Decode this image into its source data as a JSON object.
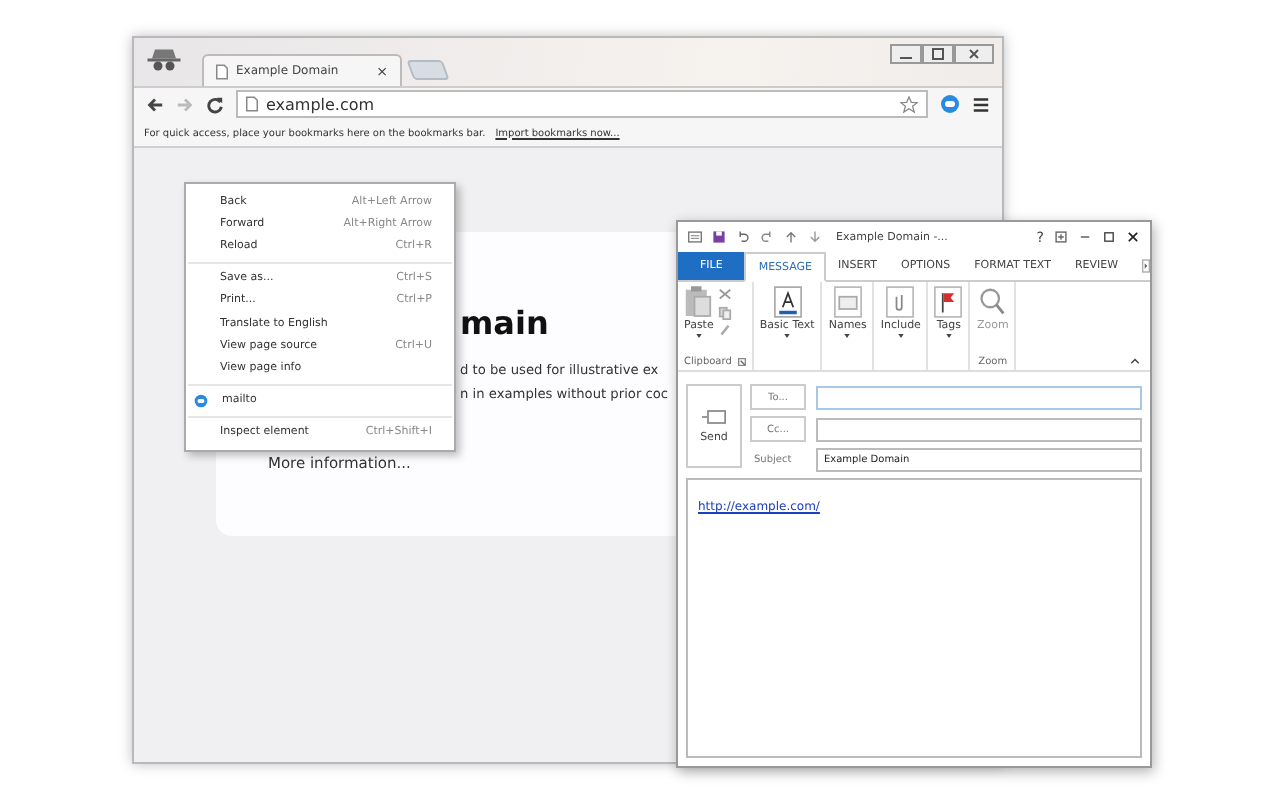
{
  "browser": {
    "tab_title": "Example Domain",
    "tab_close": "×",
    "address": "example.com",
    "bookmarks_prompt": "For quick access, place your bookmarks here on the bookmarks bar.",
    "bookmarks_link": "Import bookmarks now...",
    "page": {
      "heading": "main",
      "lines": [
        "d to be used for illustrative ex",
        "n in examples without prior coc"
      ],
      "link": "More information..."
    }
  },
  "context_menu": [
    {
      "kind": "item",
      "label": "Back",
      "shortcut": "Alt+Left Arrow"
    },
    {
      "kind": "item",
      "label": "Forward",
      "shortcut": "Alt+Right Arrow"
    },
    {
      "kind": "item",
      "label": "Reload",
      "shortcut": "Ctrl+R"
    },
    {
      "kind": "separator"
    },
    {
      "kind": "item",
      "label": "Save as...",
      "shortcut": "Ctrl+S"
    },
    {
      "kind": "item",
      "label": "Print...",
      "shortcut": "Ctrl+P"
    },
    {
      "kind": "item",
      "label": "Translate to English"
    },
    {
      "kind": "item",
      "label": "View page source",
      "shortcut": "Ctrl+U"
    },
    {
      "kind": "item",
      "label": "View page info"
    },
    {
      "kind": "separator"
    },
    {
      "kind": "extension",
      "label": "mailto"
    },
    {
      "kind": "separator"
    },
    {
      "kind": "item",
      "label": "Inspect element",
      "shortcut": "Ctrl+Shift+I"
    }
  ],
  "compose": {
    "title": "Example Domain -...",
    "help": "?",
    "tabs": [
      {
        "label": "FILE",
        "kind": "file",
        "selected": false
      },
      {
        "label": "MESSAGE",
        "kind": "tab",
        "selected": true
      },
      {
        "label": "INSERT",
        "kind": "tab",
        "selected": false
      },
      {
        "label": "OPTIONS",
        "kind": "tab",
        "selected": false
      },
      {
        "label": "FORMAT TEXT",
        "kind": "tab",
        "selected": false
      },
      {
        "label": "REVIEW",
        "kind": "tab",
        "selected": false
      }
    ],
    "groups": [
      {
        "name": "Clipboard",
        "buttons": [
          {
            "kind": "paste",
            "label": "Paste",
            "dropdown": true
          }
        ]
      },
      {
        "buttons": [
          {
            "kind": "text",
            "label": "Basic Text",
            "dropdown": true
          }
        ]
      },
      {
        "buttons": [
          {
            "kind": "names",
            "label": "Names",
            "dropdown": true
          }
        ]
      },
      {
        "buttons": [
          {
            "kind": "include",
            "label": "Include",
            "dropdown": true
          }
        ]
      },
      {
        "buttons": [
          {
            "kind": "tags",
            "label": "Tags",
            "dropdown": true
          }
        ]
      },
      {
        "name": "Zoom",
        "buttons": [
          {
            "kind": "zoom",
            "label": "Zoom",
            "dropdown": false
          }
        ]
      }
    ],
    "send": "Send",
    "to_button": "To...",
    "cc_button": "Cc...",
    "subject_label": "Subject",
    "subject": "Example Domain",
    "body_link": "http://example.com/"
  }
}
